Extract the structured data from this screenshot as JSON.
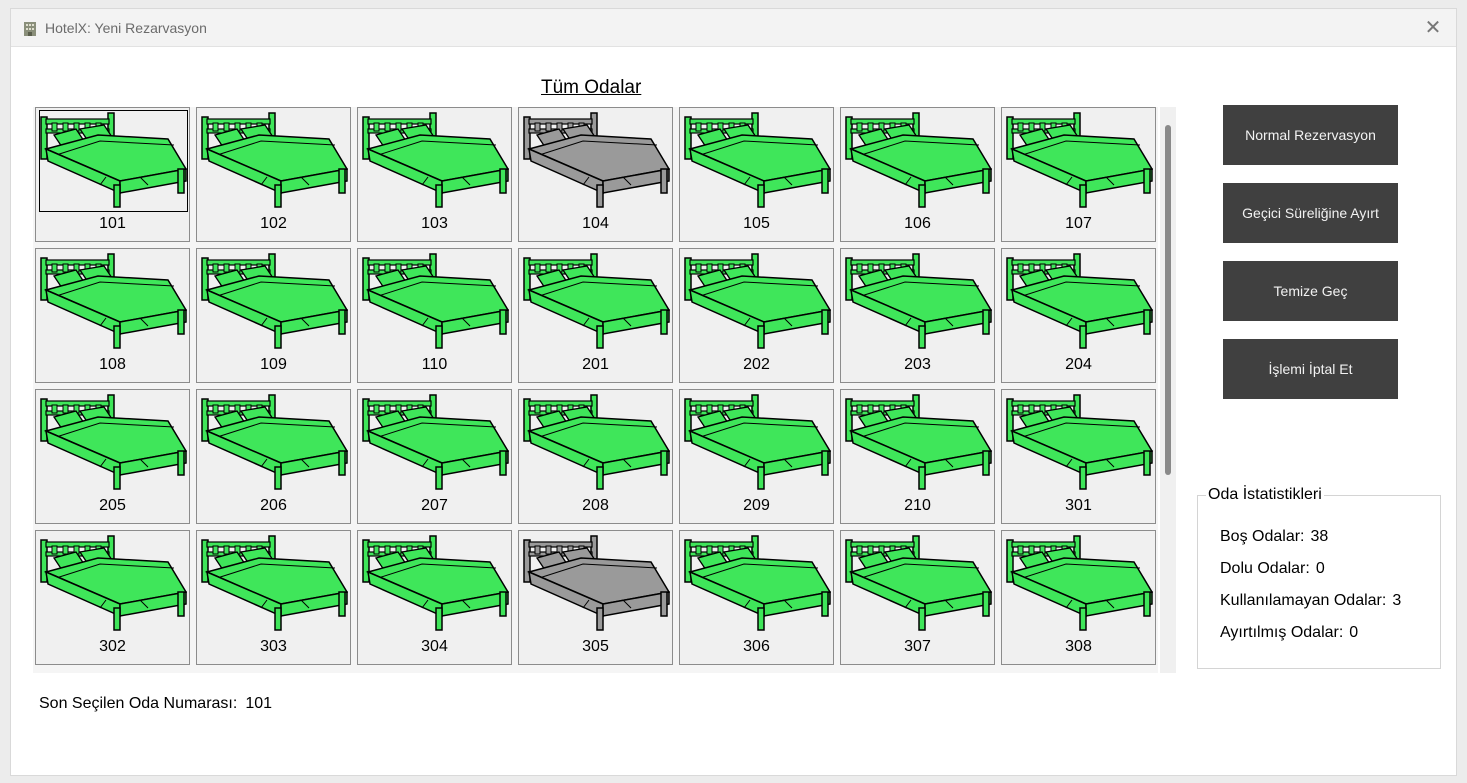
{
  "window": {
    "title": "HotelX: Yeni Rezarvasyon",
    "close_glyph": "✕"
  },
  "rooms_title": "Tüm Odalar",
  "colors": {
    "available": "#3fe65a",
    "unavailable": "#9a9a9a",
    "button_bg": "#404040"
  },
  "rooms": [
    {
      "number": "101",
      "status": "available",
      "selected": true
    },
    {
      "number": "102",
      "status": "available"
    },
    {
      "number": "103",
      "status": "available"
    },
    {
      "number": "104",
      "status": "unavailable"
    },
    {
      "number": "105",
      "status": "available"
    },
    {
      "number": "106",
      "status": "available"
    },
    {
      "number": "107",
      "status": "available"
    },
    {
      "number": "108",
      "status": "available"
    },
    {
      "number": "109",
      "status": "available"
    },
    {
      "number": "110",
      "status": "available"
    },
    {
      "number": "201",
      "status": "available"
    },
    {
      "number": "202",
      "status": "available"
    },
    {
      "number": "203",
      "status": "available"
    },
    {
      "number": "204",
      "status": "available"
    },
    {
      "number": "205",
      "status": "available"
    },
    {
      "number": "206",
      "status": "available"
    },
    {
      "number": "207",
      "status": "available"
    },
    {
      "number": "208",
      "status": "available"
    },
    {
      "number": "209",
      "status": "available"
    },
    {
      "number": "210",
      "status": "available"
    },
    {
      "number": "301",
      "status": "available"
    },
    {
      "number": "302",
      "status": "available"
    },
    {
      "number": "303",
      "status": "available"
    },
    {
      "number": "304",
      "status": "available"
    },
    {
      "number": "305",
      "status": "unavailable"
    },
    {
      "number": "306",
      "status": "available"
    },
    {
      "number": "307",
      "status": "available"
    },
    {
      "number": "308",
      "status": "available"
    }
  ],
  "actions": {
    "normal": "Normal Rezervasyon",
    "temporary": "Geçici Süreliğine Ayırt",
    "clean": "Temize Geç",
    "cancel": "İşlemi İptal Et"
  },
  "stats": {
    "title": "Oda İstatistikleri",
    "empty_label": "Boş Odalar:",
    "empty_value": "38",
    "occupied_label": "Dolu Odalar:",
    "occupied_value": "0",
    "unusable_label": "Kullanılamayan Odalar:",
    "unusable_value": "3",
    "reserved_label": "Ayırtılmış Odalar:",
    "reserved_value": "0"
  },
  "last_selected": {
    "label": "Son Seçilen Oda Numarası:",
    "value": "101"
  }
}
